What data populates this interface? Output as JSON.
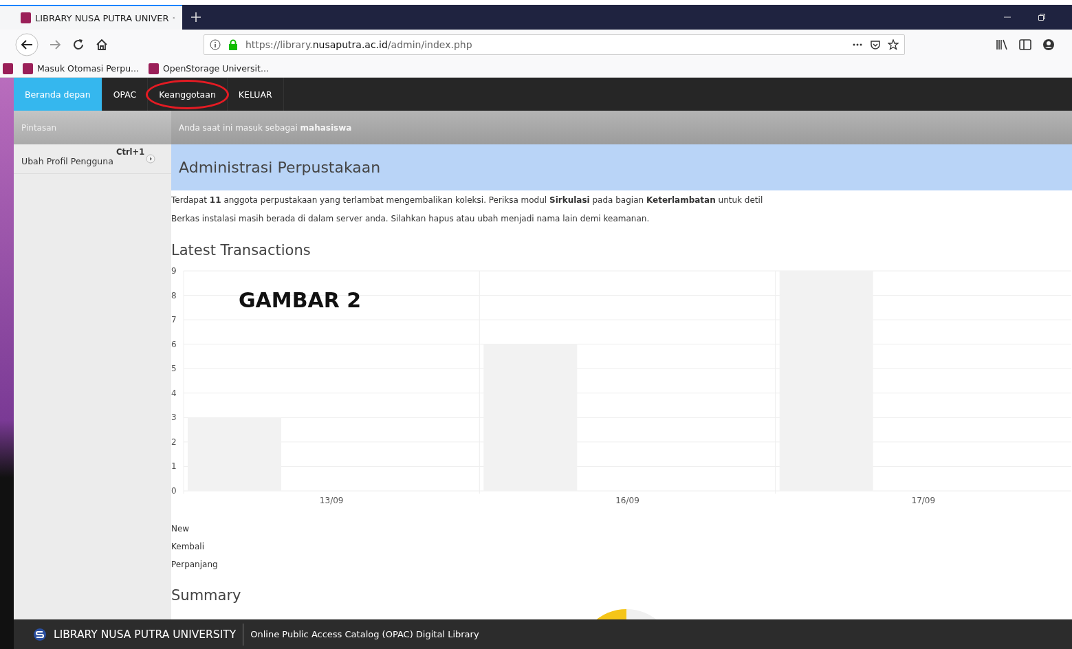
{
  "browser": {
    "tab_title": "LIBRARY NUSA PUTRA UNIVER",
    "url_host": "https://library.",
    "url_domain": "nusaputra.ac.id",
    "url_path": "/admin/index.php",
    "bookmarks": [
      "Masuk Otomasi Perpu...",
      "OpenStorage Universit..."
    ]
  },
  "nav": [
    {
      "label": "Beranda depan",
      "selected": true,
      "circled": false
    },
    {
      "label": "OPAC",
      "selected": false,
      "circled": false
    },
    {
      "label": "Keanggotaan",
      "selected": false,
      "circled": true
    },
    {
      "label": "KELUAR",
      "selected": false,
      "circled": false
    }
  ],
  "sidebar": {
    "title": "Pintasan",
    "items": [
      {
        "label": "Ubah Profil Pengguna",
        "shortcut": "Ctrl+1"
      }
    ]
  },
  "info_bar": "Anda saat ini masuk sebagai **mahasiswa**",
  "page_title": "Administrasi Perpustakaan",
  "messages": [
    "Terdapat **11** anggota perpustakaan yang terlambat mengembalikan koleksi. Periksa modul **Sirkulasi** pada bagian **Keterlambatan** untuk detil",
    "Berkas instalasi masih berada di dalam server anda. Silahkan hapus atau ubah menjadi nama lain demi keamanan."
  ],
  "latest_title": "Latest Transactions",
  "chart_data": {
    "type": "bar",
    "categories": [
      "13/09",
      "16/09",
      "17/09"
    ],
    "grid": true,
    "series": [
      {
        "color": "#f2f2f2",
        "values": [
          3,
          6,
          9
        ]
      }
    ],
    "ylim": [
      0,
      9
    ],
    "yticks": [
      0,
      1,
      2,
      3,
      4,
      5,
      6,
      7,
      8,
      9
    ],
    "annotations": [
      "GAMBAR 2"
    ]
  },
  "legend": [
    "New",
    "Kembali",
    "Perpanjang"
  ],
  "summary_title": "Summary",
  "footer": {
    "brand": "LIBRARY NUSA PUTRA UNIVERSITY",
    "subtitle": "Online Public Access Catalog (OPAC) Digital Library"
  }
}
